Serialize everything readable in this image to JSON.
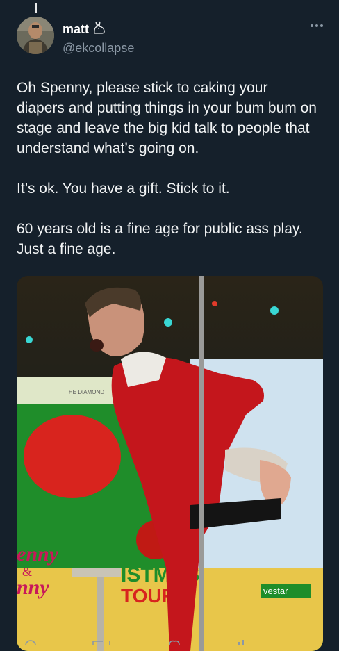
{
  "author": {
    "display_name": "matt",
    "handle": "@ekcollapse"
  },
  "tweet": {
    "paragraphs": [
      "Oh Spenny, please stick to caking your\ndiapers and putting things in your bum bum on\nstage and leave the big kid talk to people that\nunderstand what’s going on.",
      "It’s ok. You have a gift. Stick to it.",
      "60 years old is a fine age for public ass play.\nJust a fine age."
    ]
  },
  "media": {
    "screen_text": [
      "THE DIAMOND",
      "enny",
      "&",
      "nny",
      "ISTMAS",
      "TOUR",
      "vestar"
    ]
  },
  "colors": {
    "background": "#15202b",
    "text": "#e7e9ea",
    "secondary": "#8b98a5"
  },
  "icons": [
    "rabbit-icon",
    "more-icon",
    "reply-icon",
    "retweet-icon",
    "like-icon",
    "views-icon"
  ]
}
